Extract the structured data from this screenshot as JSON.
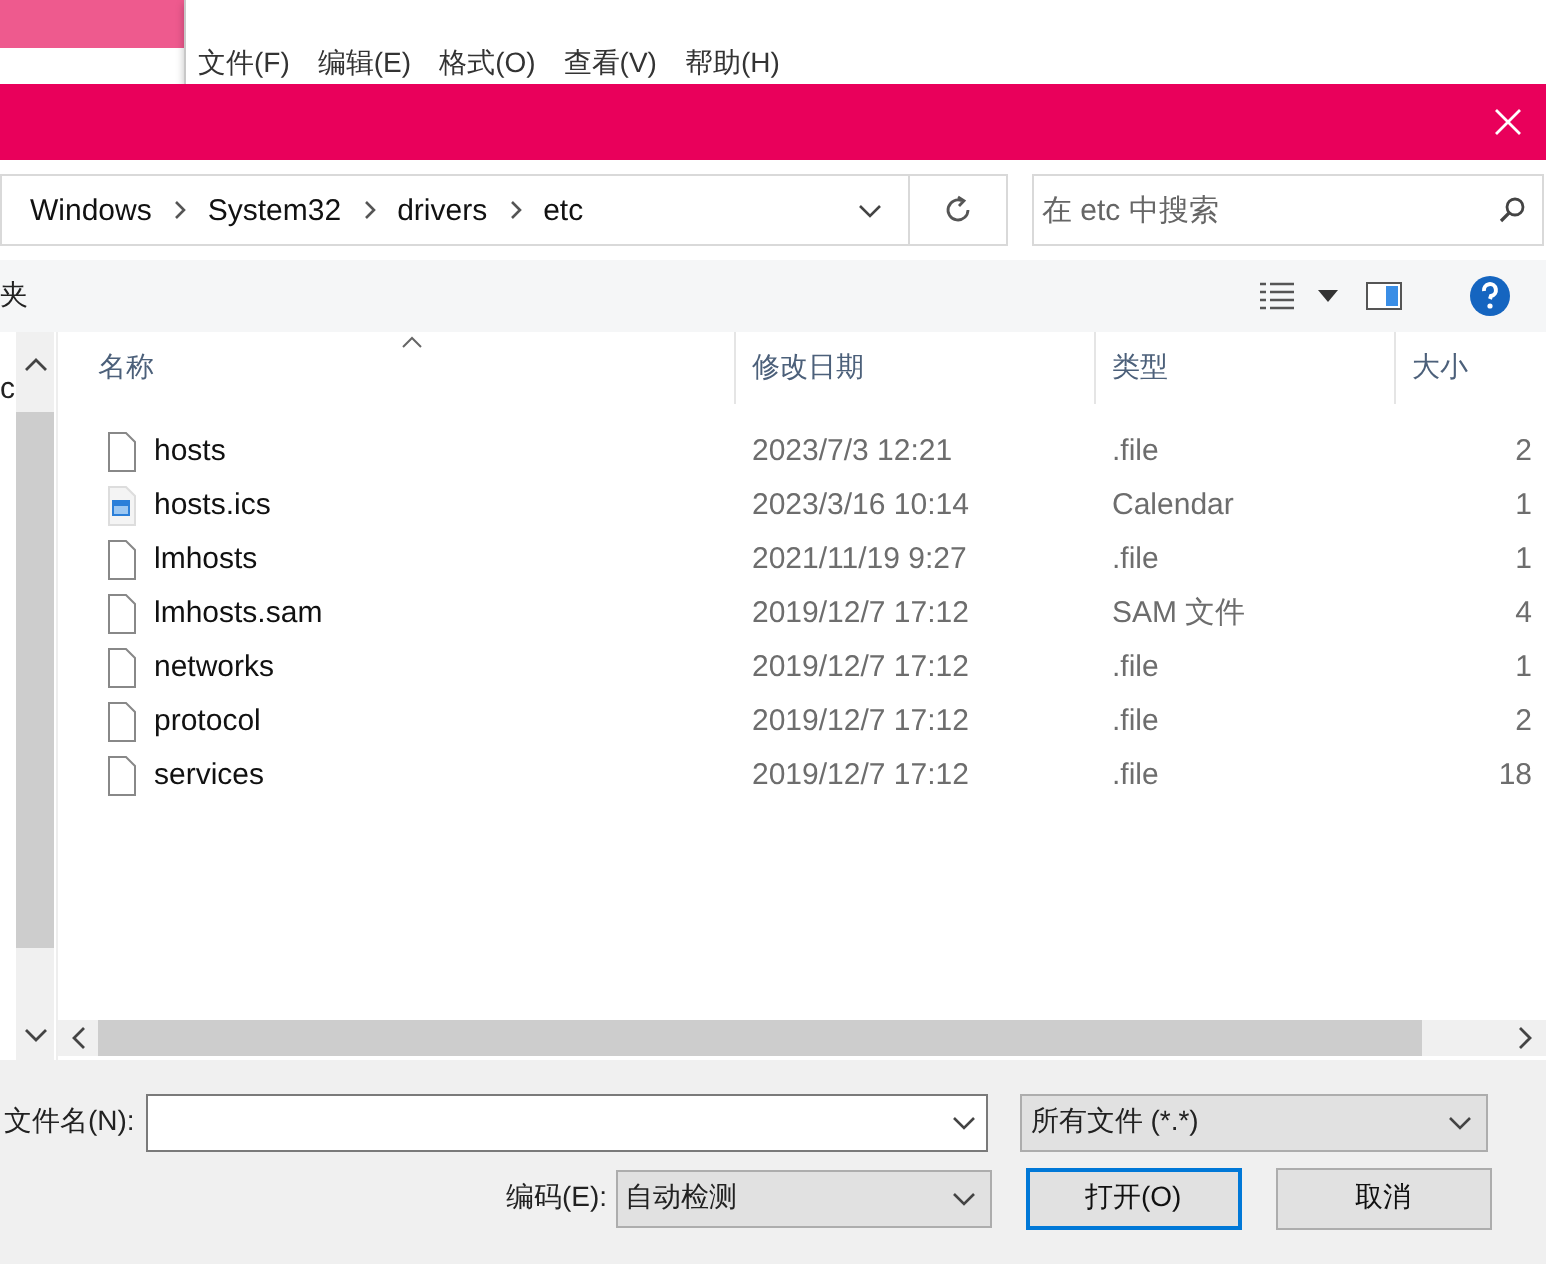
{
  "notepad": {
    "menu": [
      "文件(F)",
      "编辑(E)",
      "格式(O)",
      "查看(V)",
      "帮助(H)"
    ]
  },
  "dialog": {
    "breadcrumb": [
      "Windows",
      "System32",
      "drivers",
      "etc"
    ],
    "search": {
      "placeholder": "在 etc 中搜索"
    },
    "toolbar": {
      "label": "夹"
    },
    "nav_pane": {
      "label": "c"
    },
    "table": {
      "columns": [
        {
          "label": "名称",
          "sorted": true
        },
        {
          "label": "修改日期",
          "sorted": false
        },
        {
          "label": "类型",
          "sorted": false
        },
        {
          "label": "大小",
          "sorted": false
        }
      ],
      "rows": [
        {
          "kind": "file",
          "name": "hosts",
          "date": "2023/7/3 12:21",
          "type": ".file",
          "size": "2"
        },
        {
          "kind": "calendar",
          "name": "hosts.ics",
          "date": "2023/3/16 10:14",
          "type": "Calendar",
          "size": "1"
        },
        {
          "kind": "file",
          "name": "lmhosts",
          "date": "2021/11/19 9:27",
          "type": ".file",
          "size": "1"
        },
        {
          "kind": "file",
          "name": "lmhosts.sam",
          "date": "2019/12/7 17:12",
          "type": "SAM 文件",
          "size": "4"
        },
        {
          "kind": "file",
          "name": "networks",
          "date": "2019/12/7 17:12",
          "type": ".file",
          "size": "1"
        },
        {
          "kind": "file",
          "name": "protocol",
          "date": "2019/12/7 17:12",
          "type": ".file",
          "size": "2"
        },
        {
          "kind": "file",
          "name": "services",
          "date": "2019/12/7 17:12",
          "type": ".file",
          "size": "18"
        }
      ]
    },
    "file_name": {
      "label": "文件名(N):"
    },
    "file_type": {
      "value": "所有文件  (*.*)"
    },
    "encoding": {
      "label": "编码(E):",
      "value": "自动检测"
    },
    "buttons": [
      {
        "label": "打开(O)",
        "default": true
      },
      {
        "label": "取消",
        "default": false
      }
    ]
  }
}
